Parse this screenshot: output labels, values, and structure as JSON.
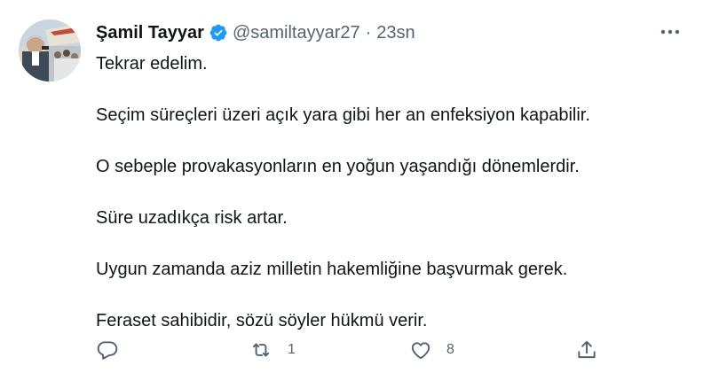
{
  "tweet": {
    "author": {
      "display_name": "Şamil Tayyar",
      "handle": "@samiltayyar27",
      "verified": true
    },
    "separator": "·",
    "timestamp": "23sn",
    "lines": [
      "Tekrar edelim.",
      "Seçim süreçleri üzeri açık yara gibi her an enfeksiyon kapabilir.",
      "O sebeple provakasyonların en yoğun yaşandığı dönemlerdir.",
      "Süre uzadıkça risk artar.",
      "Uygun zamanda aziz milletin hakemliğine başvurmak gerek.",
      "Feraset sahibidir, sözü söyler hükmü verir."
    ],
    "actions": {
      "reply_count": "",
      "retweet_count": "1",
      "like_count": "8"
    }
  },
  "colors": {
    "text": "#0f1419",
    "secondary": "#536471",
    "verified_blue": "#1d9bf0",
    "background": "#ffffff"
  },
  "icons": {
    "verified": "verified-badge-icon",
    "more": "more-horizontal-icon",
    "reply": "reply-icon",
    "retweet": "retweet-icon",
    "like": "heart-icon",
    "share": "share-icon"
  }
}
